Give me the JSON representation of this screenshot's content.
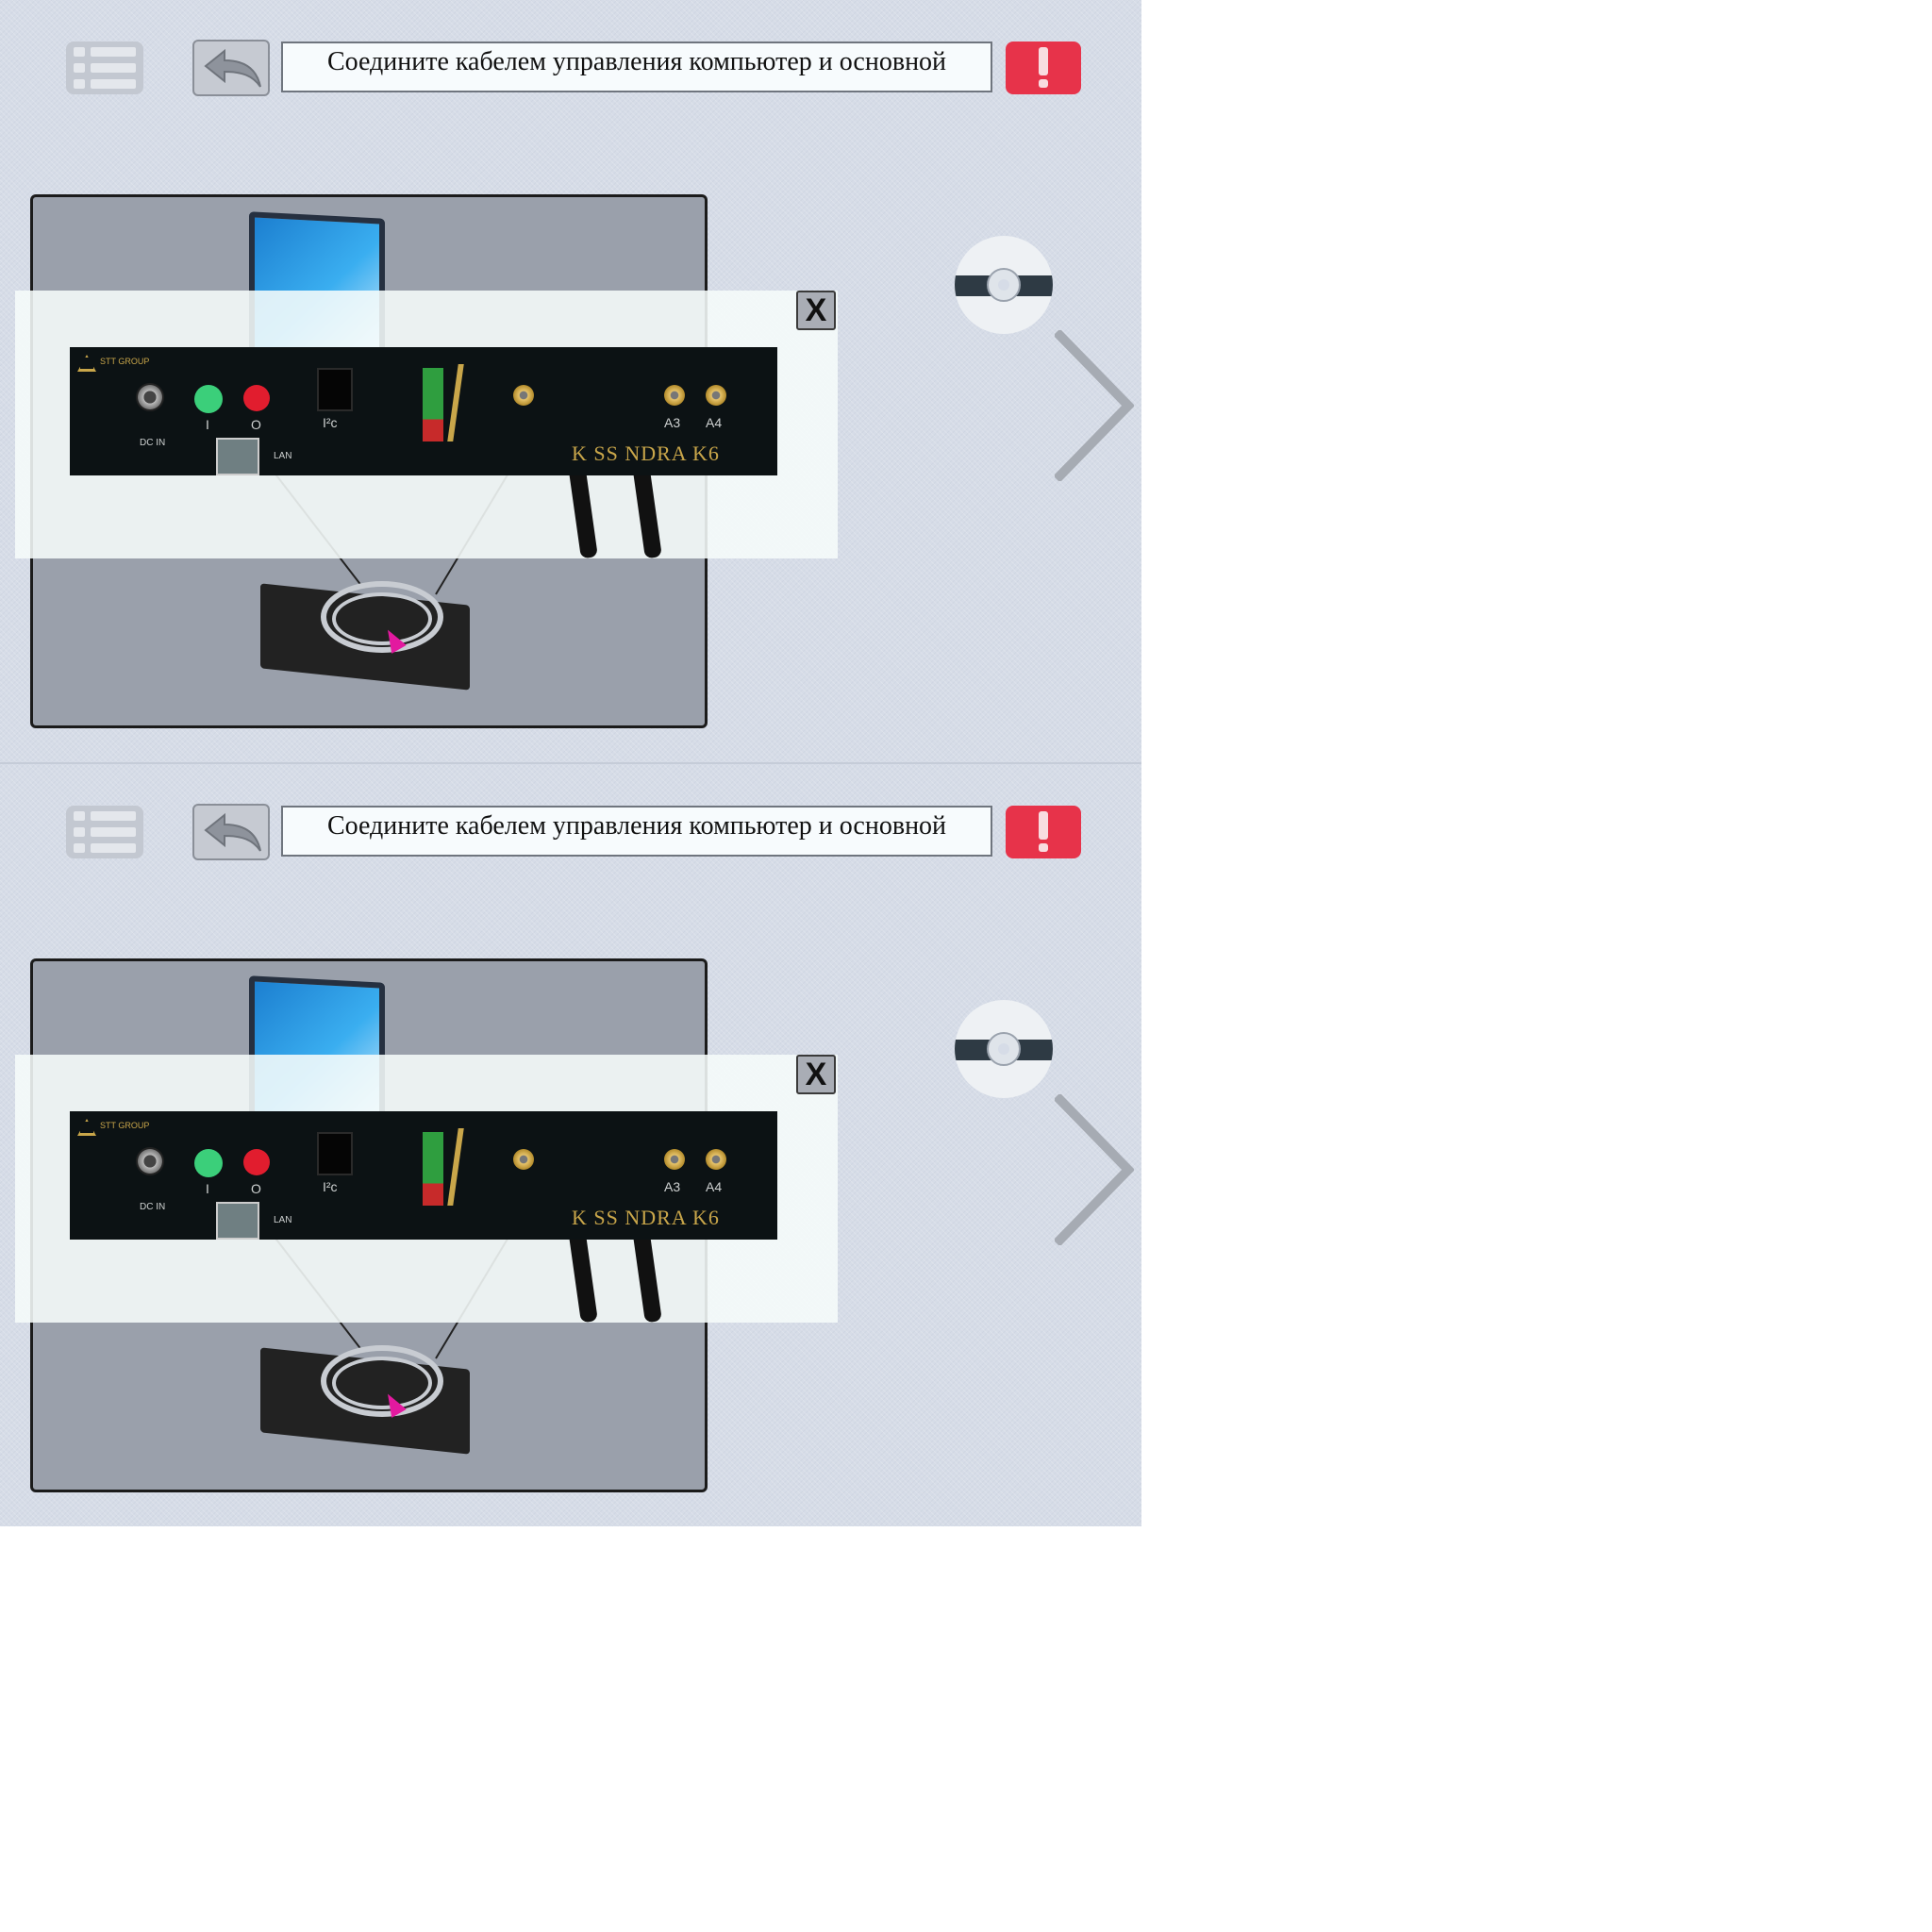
{
  "frames": [
    {
      "toolbar": {
        "menu_icon": "list-menu-icon",
        "back_icon": "undo-arrow-icon",
        "instruction": "Соедините кабелем управления компьютер и основной",
        "alert_icon": "exclamation-icon"
      },
      "popup": {
        "close_label": "X",
        "panel": {
          "brand": "STT GROUP",
          "dc_in": "DC IN",
          "on_label": "I",
          "off_label": "O",
          "i2c_label": "I²c",
          "lan_label": "LAN",
          "a3_label": "A3",
          "a4_label": "A4",
          "model": "K  SS  NDRA K6"
        }
      },
      "disc_icon": "software-disc-icon",
      "next_icon": "chevron-right-icon"
    },
    {
      "toolbar": {
        "menu_icon": "list-menu-icon",
        "back_icon": "undo-arrow-icon",
        "instruction": "Соедините кабелем управления компьютер и основной",
        "alert_icon": "exclamation-icon"
      },
      "popup": {
        "close_label": "X",
        "panel": {
          "brand": "STT GROUP",
          "dc_in": "DC IN",
          "on_label": "I",
          "off_label": "O",
          "i2c_label": "I²c",
          "lan_label": "LAN",
          "a3_label": "A3",
          "a4_label": "A4",
          "model": "K  SS  NDRA K6"
        }
      },
      "disc_icon": "software-disc-icon",
      "next_icon": "chevron-right-icon"
    }
  ],
  "colors": {
    "background": "#d6dce7",
    "alert": "#e7334a",
    "panel": "#0c1214",
    "gold": "#c9a64a",
    "cursor": "#e3199f"
  }
}
